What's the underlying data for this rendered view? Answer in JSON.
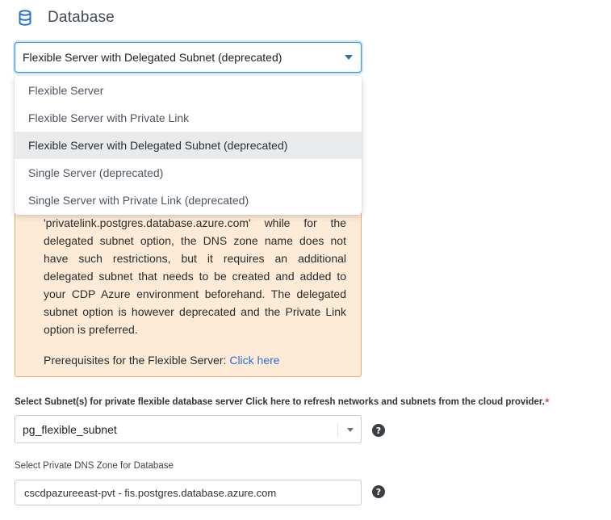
{
  "header": {
    "title": "Database",
    "icon": "database-icon",
    "accent_color": "#2a6fd6"
  },
  "database_type_select": {
    "selected": "Flexible Server with Delegated Subnet (deprecated)",
    "options": [
      "Flexible Server",
      "Flexible Server with Private Link",
      "Flexible Server with Delegated Subnet (deprecated)",
      "Single Server (deprecated)",
      "Single Server with Private Link (deprecated)"
    ]
  },
  "warning": {
    "text": "'privatelink.postgres.database.azure.com' while for the delegated subnet option, the DNS zone name does not have such restrictions, but it requires an additional delegated subnet that needs to be created and added to your CDP Azure environment beforehand. The delegated subnet option is however deprecated and the Private Link option is preferred.",
    "prereq_label": "Prerequisites for the Flexible Server:",
    "prereq_link": "Click here",
    "background_color": "#fdebd8",
    "border_color": "#f0a868"
  },
  "subnet": {
    "label": "Select Subnet(s) for private flexible database server Click here to refresh networks and subnets from the cloud provider.",
    "required_mark": "*",
    "value": "pg_flexible_subnet"
  },
  "dns_zone": {
    "label": "Select Private DNS Zone for Database",
    "value": "cscdpazureeast-pvt - fis.postgres.database.azure.com"
  },
  "help_glyph": "?"
}
